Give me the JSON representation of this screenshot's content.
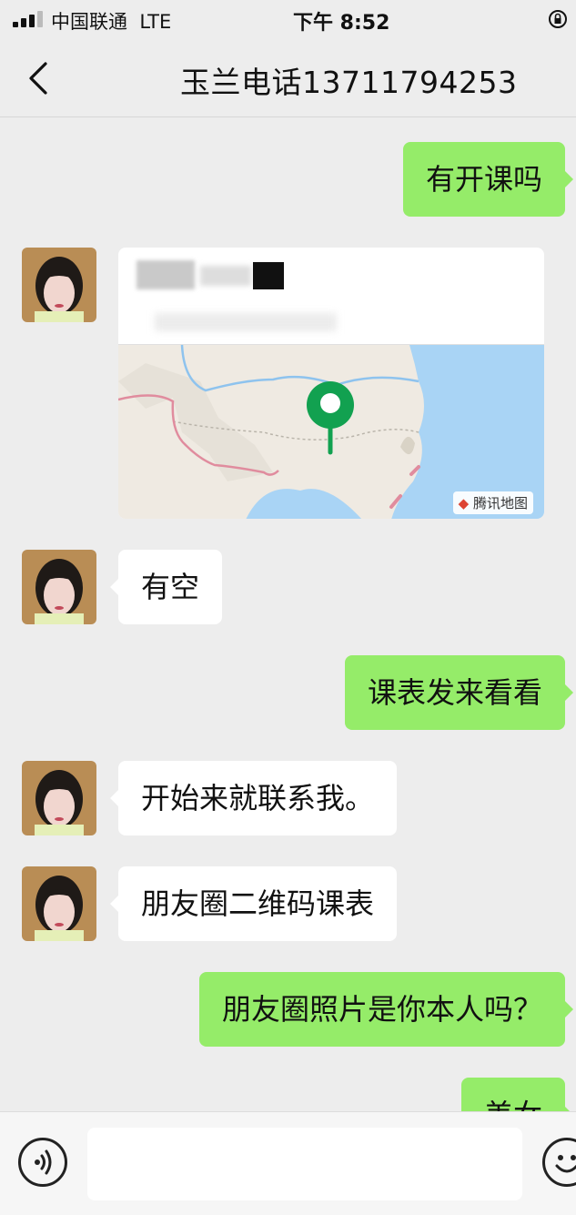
{
  "status_bar": {
    "carrier": "中国联通",
    "network": "LTE",
    "time": "下午 8:52"
  },
  "nav": {
    "title": "玉兰电话13711794253"
  },
  "messages": [
    {
      "side": "out",
      "text": "有开课吗"
    },
    {
      "side": "in",
      "type": "location"
    },
    {
      "side": "in",
      "text": "有空"
    },
    {
      "side": "out",
      "text": "课表发来看看"
    },
    {
      "side": "in",
      "text": "开始来就联系我。"
    },
    {
      "side": "in",
      "text": "朋友圈二维码课表"
    },
    {
      "side": "out",
      "text": "朋友圈照片是你本人吗？"
    },
    {
      "side": "out",
      "text": "美女"
    }
  ],
  "location_card": {
    "map_logo": "腾讯地图"
  },
  "colors": {
    "outgoing_bubble": "#95ec69",
    "incoming_bubble": "#ffffff",
    "background": "#ededed",
    "pin": "#12a150"
  }
}
